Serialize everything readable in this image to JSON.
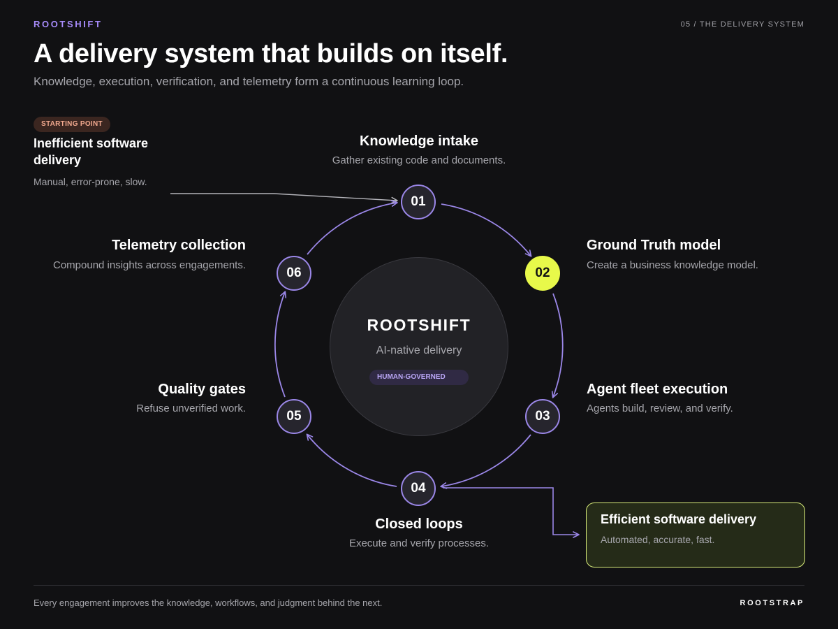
{
  "header": {
    "brand": "ROOTSHIFT",
    "slide_label": "05 / THE DELIVERY SYSTEM",
    "title": "A delivery system that builds on itself.",
    "subtitle": "Knowledge, execution, verification, and telemetry form a continuous learning loop."
  },
  "starting_point": {
    "badge": "STARTING POINT",
    "title": "Inefficient software delivery",
    "description": "Manual, error-prone, slow."
  },
  "center": {
    "title": "ROOTSHIFT",
    "subtitle": "AI-native delivery",
    "badge": "HUMAN-GOVERNED"
  },
  "steps": [
    {
      "number": "01",
      "title": "Knowledge intake",
      "description": "Gather existing code and documents."
    },
    {
      "number": "02",
      "title": "Ground Truth model",
      "description": "Create a business knowledge model."
    },
    {
      "number": "03",
      "title": "Agent fleet execution",
      "description": "Agents build, review, and verify."
    },
    {
      "number": "04",
      "title": "Closed loops",
      "description": "Execute and verify processes."
    },
    {
      "number": "05",
      "title": "Quality gates",
      "description": "Refuse unverified work."
    },
    {
      "number": "06",
      "title": "Telemetry collection",
      "description": "Compound insights across engagements."
    }
  ],
  "result": {
    "title": "Efficient software delivery",
    "description": "Automated, accurate, fast."
  },
  "footer": {
    "text": "Every engagement improves the knowledge, workflows, and judgment behind the next.",
    "brand": "ROOTSTRAP"
  },
  "colors": {
    "background": "#111113",
    "accent_purple": "#9b87e8",
    "highlight_lime": "#e8f94a",
    "start_badge": "#f0a88e",
    "text_muted": "#a6a6ac"
  }
}
